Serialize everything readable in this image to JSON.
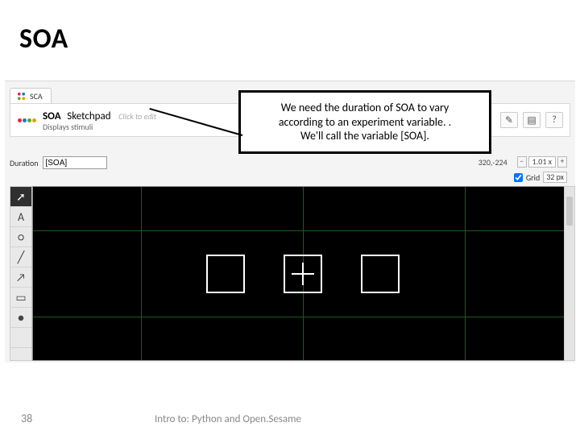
{
  "slide": {
    "title": "SOA",
    "page_number": "38",
    "footer": "Intro to: Python and Open.Sesame"
  },
  "callout": {
    "line1": "We need the duration of SOA to vary",
    "line2": "according to an experiment variable. .",
    "line3": "We'll call the variable [SOA]."
  },
  "app": {
    "tab_label": "SCA",
    "item_name": "SOA",
    "item_type": "Sketchpad",
    "click_hint": "Click to edit",
    "description": "Displays stimuli",
    "duration_label": "Duration",
    "duration_value": "[SOA]",
    "coords": "320,-224",
    "zoom": "1.01 x",
    "grid_label": "Grid",
    "grid_value": "32 px"
  },
  "tools": [
    {
      "name": "arrow-tool-icon",
      "glyph": "➚",
      "active": true
    },
    {
      "name": "text-tool-icon",
      "glyph": "A",
      "active": false
    },
    {
      "name": "circle-tool-icon",
      "glyph": "○",
      "active": false
    },
    {
      "name": "line-tool-icon",
      "glyph": "╱",
      "active": false
    },
    {
      "name": "arrow-shape-icon",
      "glyph": "↗",
      "active": false
    },
    {
      "name": "rect-tool-icon",
      "glyph": "▭",
      "active": false
    },
    {
      "name": "ellipse-fill-icon",
      "glyph": "●",
      "active": false
    },
    {
      "name": "blank-tool-icon",
      "glyph": "",
      "active": false
    }
  ],
  "header_buttons": [
    {
      "name": "script-button-icon",
      "glyph": "✎"
    },
    {
      "name": "split-button-icon",
      "glyph": "▤"
    },
    {
      "name": "help-button-icon",
      "glyph": "?"
    }
  ]
}
